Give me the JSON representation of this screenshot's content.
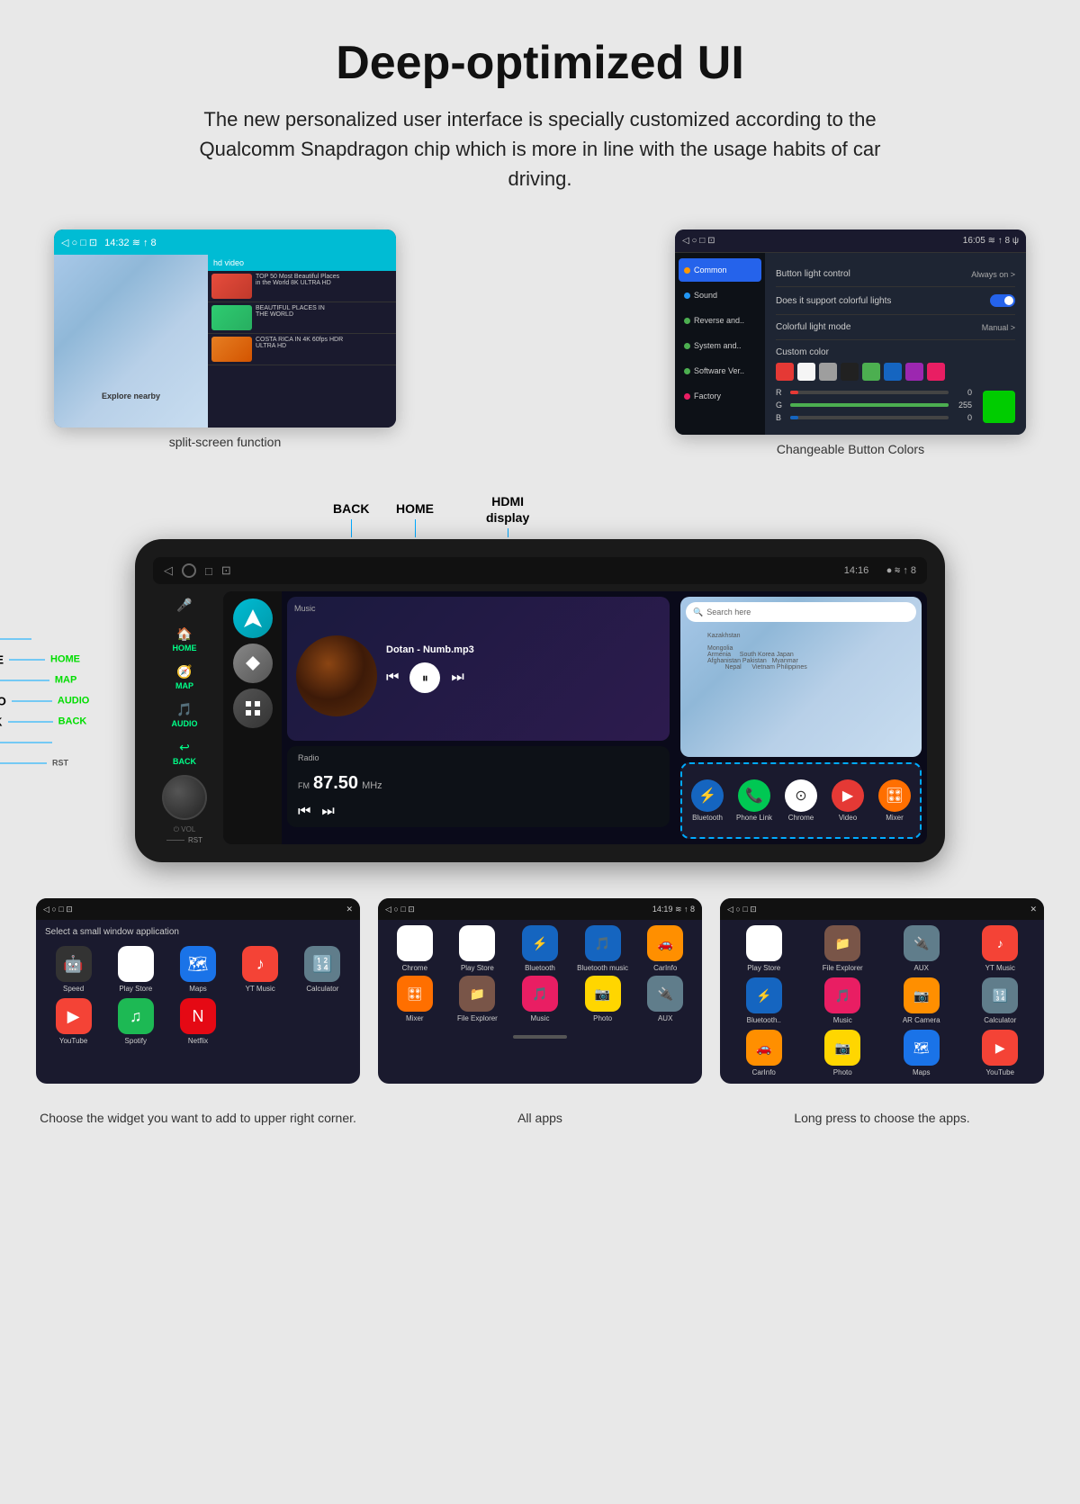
{
  "header": {
    "title": "Deep-optimized UI",
    "description": "The new personalized user interface is specially customized according to the Qualcomm Snapdragon chip which is more in line with the usage habits of car driving."
  },
  "topLeft": {
    "caption": "split-screen function",
    "mapLabel": "Explore nearby",
    "videoTitle": "hd video"
  },
  "topRight": {
    "caption": "Changeable Button Colors",
    "sidebarItems": [
      "Common",
      "Sound",
      "Reverse and..",
      "System and..",
      "Software Ver..",
      "Factory"
    ],
    "rows": [
      {
        "label": "Button light control",
        "value": "Always on >"
      },
      {
        "label": "Does it support colorful lights",
        "value": "toggle"
      },
      {
        "label": "Colorful light mode",
        "value": "Manual >"
      }
    ],
    "colorsTitle": "Custom color",
    "rLabel": "R",
    "rValue": "0",
    "gLabel": "G",
    "gValue": "255",
    "bLabel": "B",
    "bValue": "0"
  },
  "carLabels": {
    "topLabels": [
      "BACK",
      "HOME",
      "HDMI\ndisplay"
    ],
    "leftLabels": [
      {
        "name": "MIC",
        "btn": ""
      },
      {
        "name": "HOME",
        "btn": "HOME"
      },
      {
        "name": "MAP",
        "btn": "MAP"
      },
      {
        "name": "AUDIO",
        "btn": "AUDIO"
      },
      {
        "name": "BACK",
        "btn": "BACK"
      },
      {
        "name": "VOL",
        "btn": ""
      },
      {
        "name": "RST",
        "btn": "RST"
      }
    ]
  },
  "carScreen": {
    "statusTime": "14:16",
    "music": {
      "label": "Music",
      "track": "Dotan - Numb.mp3"
    },
    "radio": {
      "label": "Radio",
      "freq": "87.50",
      "unit": "MHz",
      "band": "FM"
    },
    "mapSearch": "Search here",
    "apps": [
      {
        "label": "Bluetooth",
        "color": "bt"
      },
      {
        "label": "Phone Link",
        "color": "phone"
      },
      {
        "label": "Chrome",
        "color": "chrome"
      },
      {
        "label": "Video",
        "color": "video"
      },
      {
        "label": "Mixer",
        "color": "mixer"
      }
    ]
  },
  "bottomLeft": {
    "title": "Select a small window application",
    "apps": [
      {
        "label": "Speed",
        "color": "speed",
        "icon": "🤖"
      },
      {
        "label": "Play Store",
        "color": "playstore",
        "icon": "▶"
      },
      {
        "label": "Maps",
        "color": "maps",
        "icon": "🗺"
      },
      {
        "label": "YT Music",
        "color": "ytmusic",
        "icon": "♪"
      },
      {
        "label": "Calculator",
        "color": "calc",
        "icon": "🔢"
      },
      {
        "label": "YouTube",
        "color": "youtube",
        "icon": "▶"
      },
      {
        "label": "Spotify",
        "color": "spotify",
        "icon": "♫"
      },
      {
        "label": "Netflix",
        "color": "netflix",
        "icon": "N"
      }
    ],
    "caption": "Choose the widget you want to add to upper right corner."
  },
  "bottomMid": {
    "title": "All apps",
    "apps": [
      {
        "label": "Chrome",
        "color": "chrome-m",
        "icon": "⊙"
      },
      {
        "label": "Play Store",
        "color": "ps-m",
        "icon": "▶"
      },
      {
        "label": "Bluetooth",
        "color": "bt-m",
        "icon": "⚡"
      },
      {
        "label": "Bluetooth music",
        "color": "btm-m",
        "icon": "🎵"
      },
      {
        "label": "CarInfo",
        "color": "carinfo-m",
        "icon": "🚗"
      },
      {
        "label": "Mixer",
        "color": "mixer-m",
        "icon": "🎛"
      },
      {
        "label": "File Explorer",
        "color": "fe-m",
        "icon": "📁"
      },
      {
        "label": "Music",
        "color": "music-m",
        "icon": "🎵"
      },
      {
        "label": "Photo",
        "color": "photo-m",
        "icon": "📷"
      },
      {
        "label": "AUX",
        "color": "aux-m",
        "icon": "🔌"
      }
    ]
  },
  "bottomRight": {
    "apps": [
      {
        "label": "Play Store",
        "color": "playstore",
        "icon": "▶"
      },
      {
        "label": "File Explorer",
        "color": "fe-m",
        "icon": "📁"
      },
      {
        "label": "AUX",
        "color": "aux-m",
        "icon": "🔌"
      },
      {
        "label": "YT Music",
        "color": "ytmusic",
        "icon": "♪"
      },
      {
        "label": "Bluetooth..",
        "color": "bt-m",
        "icon": "⚡"
      },
      {
        "label": "Music",
        "color": "music-m",
        "icon": "🎵"
      },
      {
        "label": "AR Camera",
        "color": "carinfo-m",
        "icon": "📷"
      },
      {
        "label": "Calculator",
        "color": "calc",
        "icon": "🔢"
      },
      {
        "label": "CarInfo",
        "color": "carinfo-m",
        "icon": "🚗"
      },
      {
        "label": "Photo",
        "color": "photo-m",
        "icon": "📷"
      },
      {
        "label": "Maps",
        "color": "maps",
        "icon": "🗺"
      },
      {
        "label": "YouTube",
        "color": "youtube",
        "icon": "▶"
      }
    ],
    "caption": "Long press to choose the apps."
  },
  "colors": {
    "swatches": [
      "#e53935",
      "#f5f5f5",
      "#9e9e9e",
      "#212121",
      "#4caf50",
      "#1565c0",
      "#9c27b0",
      "#e91e63"
    ]
  }
}
